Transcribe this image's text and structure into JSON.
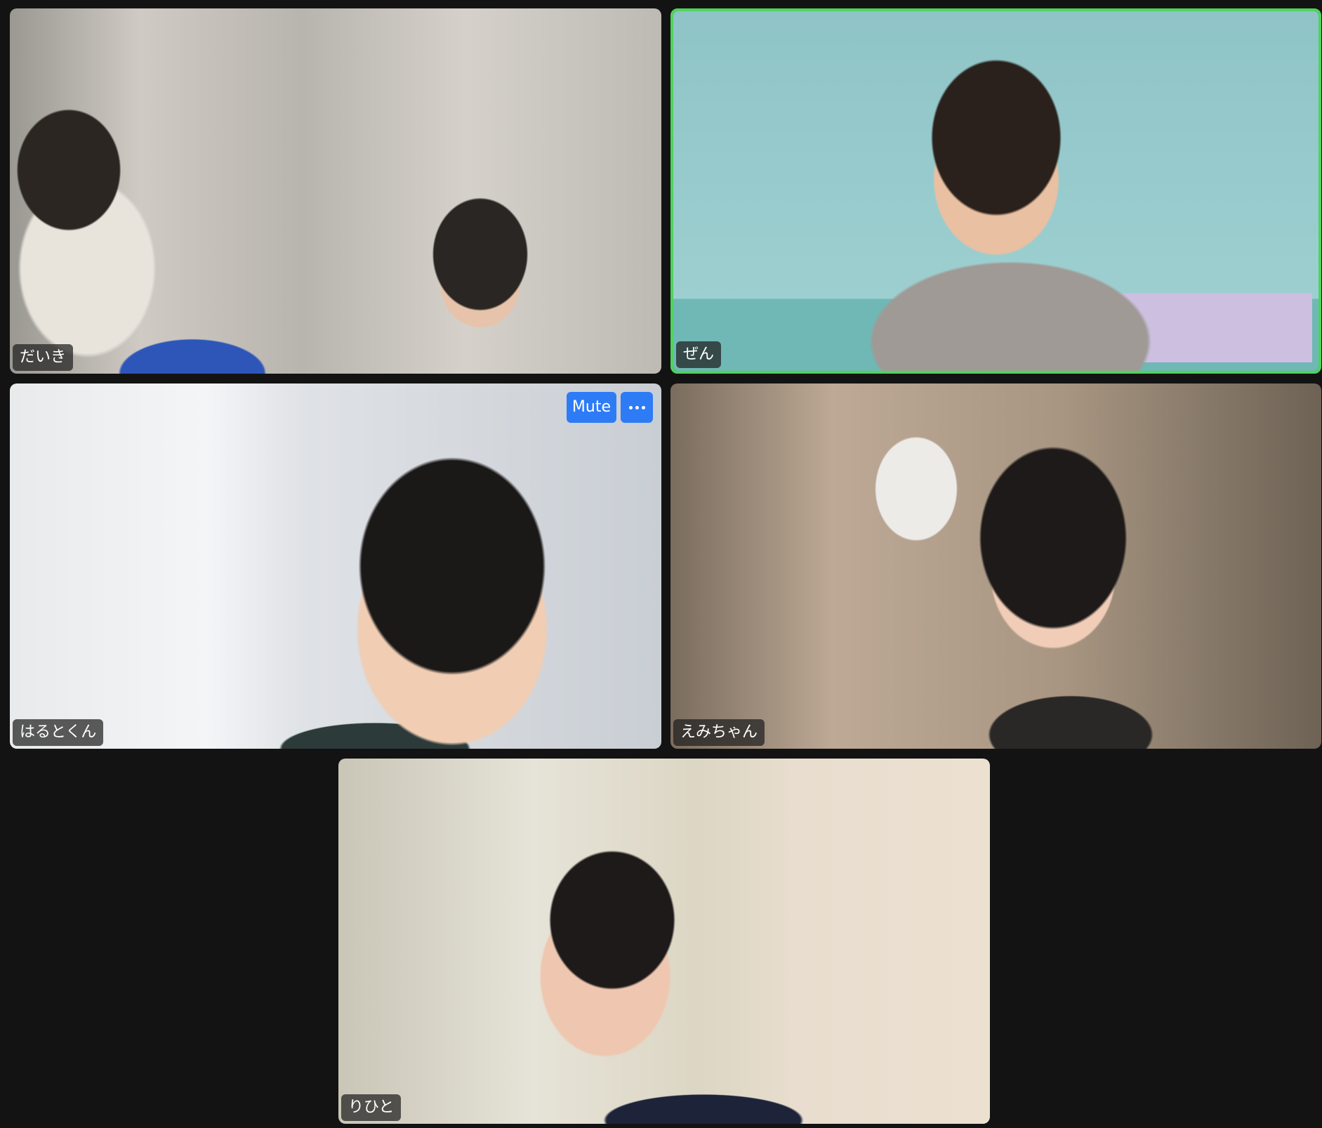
{
  "participants": [
    {
      "name": "だいき"
    },
    {
      "name": "ぜん",
      "active_speaker": true
    },
    {
      "name": "はるとくん"
    },
    {
      "name": "えみちゃん"
    },
    {
      "name": "りひと"
    }
  ],
  "tile_controls": {
    "mute_label": "Mute",
    "more_icon": "more-options-icon"
  },
  "colors": {
    "background": "#131313",
    "active_speaker_border": "#4fd35c",
    "button_accent": "#2d7cf6"
  }
}
